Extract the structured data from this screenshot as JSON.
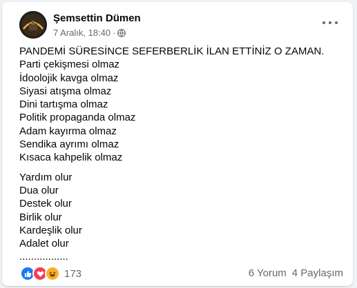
{
  "post": {
    "author": "Şemsettin Dümen",
    "timestamp": "7 Aralık, 18:40",
    "separator": "·",
    "visibility_icon": "globe-icon",
    "more_icon": "more-options-icon",
    "lines_group1": [
      "PANDEMİ SÜRESİNCE SEFERBERLİK İLAN ETTİNİZ O ZAMAN.",
      "Parti çekişmesi olmaz",
      "İdoolojik kavga olmaz",
      "Siyasi atışma olmaz",
      "Dini tartışma olmaz",
      "Politik propaganda olmaz",
      "Adam kayırma olmaz",
      "Sendika ayrımı olmaz",
      "Kısaca kahpelik olmaz"
    ],
    "lines_group2": [
      "Yardım olur",
      "Dua olur",
      "Destek olur",
      "Birlik olur",
      "Kardeşlik olur",
      "Adalet olur",
      "................."
    ]
  },
  "footer": {
    "reaction_icons": [
      "like-icon",
      "love-icon",
      "haha-icon"
    ],
    "reaction_count": "173",
    "comments": "6 Yorum",
    "shares": "4 Paylaşım"
  },
  "colors": {
    "text_primary": "#050505",
    "text_secondary": "#65676b",
    "like": "#1877f2",
    "love": "#f33e58",
    "haha": "#f7b125",
    "background": "#f0f2f5"
  }
}
